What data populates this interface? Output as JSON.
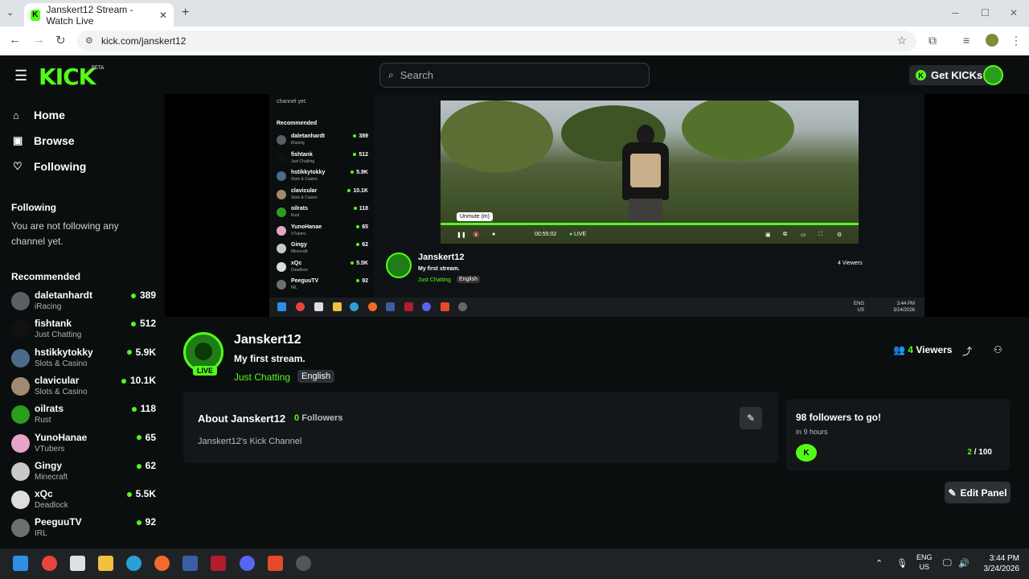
{
  "browser": {
    "tab_title": "Janskert12 Stream - Watch Live",
    "url": "kick.com/janskert12",
    "new_tab": "+",
    "tab_close": "✕"
  },
  "header": {
    "logo": "KICK",
    "logo_badge": "BETA",
    "search_placeholder": "Search",
    "get_kicks": "Get KICKs"
  },
  "sidebar": {
    "nav": [
      {
        "label": "Home",
        "icon": "home-icon"
      },
      {
        "label": "Browse",
        "icon": "browse-icon"
      },
      {
        "label": "Following",
        "icon": "heart-icon"
      }
    ],
    "following_heading": "Following",
    "following_note": "You are not following any channel yet.",
    "recommended_heading": "Recommended",
    "recommended": [
      {
        "name": "daletanhardt",
        "category": "iRacing",
        "viewers": "389",
        "color": "#5a5f66"
      },
      {
        "name": "fishtank",
        "category": "Just Chatting",
        "viewers": "512",
        "color": "#111111"
      },
      {
        "name": "hstikkytokky",
        "category": "Slots & Casino",
        "viewers": "5.9K",
        "color": "#4a6b8a"
      },
      {
        "name": "clavicular",
        "category": "Slots & Casino",
        "viewers": "10.1K",
        "color": "#a08a70"
      },
      {
        "name": "oilrats",
        "category": "Rust",
        "viewers": "118",
        "color": "#2a9d1d"
      },
      {
        "name": "YunoHanae",
        "category": "VTubers",
        "viewers": "65",
        "color": "#e8a4c8"
      },
      {
        "name": "Gingy",
        "category": "Minecraft",
        "viewers": "62",
        "color": "#c9c9c9"
      },
      {
        "name": "xQc",
        "category": "Deadlock",
        "viewers": "5.5K",
        "color": "#dddddd"
      },
      {
        "name": "PeeguuTV",
        "category": "IRL",
        "viewers": "92",
        "color": "#6f6f6f"
      }
    ]
  },
  "inner_stream": {
    "side_note": "channel yet.",
    "recommended_heading": "Recommended",
    "tooltip": "Unmute (m)",
    "time": "00:55:02",
    "live": "LIVE",
    "name": "Janskert12",
    "title": "My first stream.",
    "category": "Just Chatting",
    "language": "English",
    "viewers": "4 Viewers",
    "clock_time": "3:44 PM",
    "clock_date": "3/24/2026",
    "lang": "ENG",
    "region": "US"
  },
  "channel": {
    "name": "Janskert12",
    "title": "My first stream.",
    "category": "Just Chatting",
    "language": "English",
    "live_badge": "LIVE",
    "viewers_count": "4",
    "viewers_label": "Viewers"
  },
  "about": {
    "title": "About Janskert12",
    "followers_count": "0",
    "followers_label": "Followers",
    "description": "Janskert12's Kick Channel"
  },
  "goal": {
    "title": "98 followers to go!",
    "subtitle": "in 9 hours",
    "current": "2",
    "target": "/ 100"
  },
  "edit_panel": "Edit Panel",
  "taskbar": {
    "lang": "ENG",
    "region": "US",
    "time": "3:44 PM",
    "date": "3/24/2026"
  }
}
